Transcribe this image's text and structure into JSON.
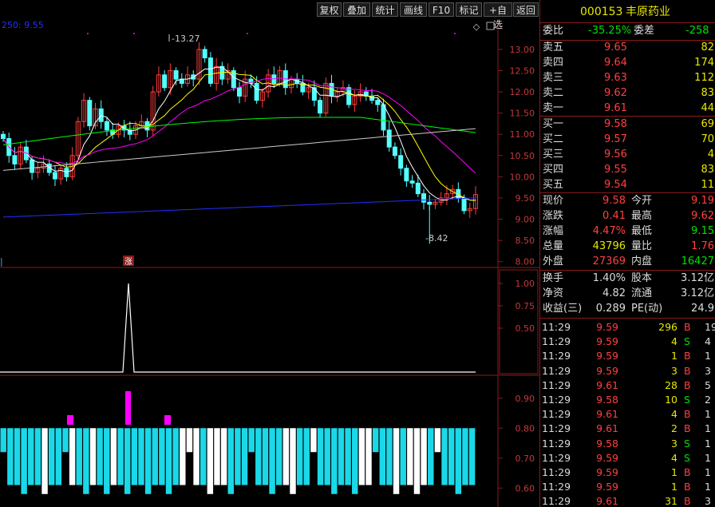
{
  "toolbar": {
    "buttons": [
      "复权",
      "叠加",
      "统计",
      "画线",
      "F10",
      "标记",
      "+自选",
      "返回"
    ]
  },
  "chart": {
    "ma_label": "250: 9.55",
    "high_label": "13.27",
    "low_label": "8.42",
    "zhang_label": "涨",
    "left_marker": "|",
    "price_ticks": [
      "13.00",
      "12.50",
      "12.00",
      "11.50",
      "11.00",
      "10.50",
      "10.00",
      "9.50",
      "9.00",
      "8.50",
      "8.00"
    ],
    "ind1_ticks": [
      "1.00",
      "0.75",
      "0.50"
    ],
    "ind2_ticks": [
      "0.90",
      "0.80",
      "0.70",
      "0.60"
    ],
    "colors": {
      "up": "#ff3c3c",
      "down": "#54ffff",
      "ma5": "#ffffff",
      "ma10": "#ffff00",
      "ma20": "#ff00ff",
      "ma60": "#00ff00",
      "ma120": "#cccccc",
      "ma250": "#2030ff",
      "grid": "#8b1a1a",
      "bar_cyan": "#1ad8e8",
      "bar_magenta": "#ff00ff"
    }
  },
  "chart_data": {
    "type": "candlestick",
    "price_range": [
      7.9,
      13.6
    ],
    "high": 13.27,
    "low": 8.42,
    "candles_close": [
      10.9,
      10.5,
      10.3,
      10.7,
      10.4,
      10.1,
      10.2,
      10.3,
      10.1,
      9.95,
      10.2,
      10.0,
      10.5,
      11.3,
      11.8,
      11.2,
      11.6,
      11.3,
      11.1,
      11.0,
      11.2,
      11.1,
      11.0,
      11.2,
      11.3,
      11.1,
      12.0,
      12.4,
      12.1,
      12.5,
      12.3,
      12.2,
      12.4,
      12.3,
      13.0,
      12.8,
      12.2,
      12.6,
      12.3,
      12.5,
      12.1,
      11.9,
      12.3,
      12.2,
      11.8,
      12.0,
      12.4,
      12.2,
      12.5,
      12.1,
      12.3,
      12.2,
      12.0,
      12.1,
      11.8,
      11.5,
      12.2,
      11.9,
      12.0,
      12.1,
      11.7,
      11.9,
      12.0,
      11.9,
      11.8,
      11.7,
      11.1,
      10.7,
      10.5,
      10.2,
      9.9,
      9.85,
      9.6,
      9.4,
      9.35,
      9.4,
      9.5,
      9.6,
      9.7,
      9.5,
      9.2,
      9.25,
      9.58
    ],
    "indicator1": {
      "spike_value": 1.0
    },
    "indicator2_range": [
      0.55,
      0.95
    ]
  },
  "quote": {
    "code": "000153",
    "name": "丰原药业",
    "weibi_label": "委比",
    "weibi_value": "-35.25%",
    "weicha_label": "委差",
    "weicha_value": "-258",
    "asks": [
      {
        "label": "卖五",
        "price": "9.65",
        "vol": "82"
      },
      {
        "label": "卖四",
        "price": "9.64",
        "vol": "174"
      },
      {
        "label": "卖三",
        "price": "9.63",
        "vol": "112"
      },
      {
        "label": "卖二",
        "price": "9.62",
        "vol": "83"
      },
      {
        "label": "卖一",
        "price": "9.61",
        "vol": "44"
      }
    ],
    "bids": [
      {
        "label": "买一",
        "price": "9.58",
        "vol": "69"
      },
      {
        "label": "买二",
        "price": "9.57",
        "vol": "70"
      },
      {
        "label": "买三",
        "price": "9.56",
        "vol": "4"
      },
      {
        "label": "买四",
        "price": "9.55",
        "vol": "83"
      },
      {
        "label": "买五",
        "price": "9.54",
        "vol": "11"
      }
    ],
    "stats": [
      {
        "l1": "现价",
        "v1": "9.58",
        "c1": "red",
        "l2": "今开",
        "v2": "9.19",
        "c2": "red"
      },
      {
        "l1": "涨跌",
        "v1": "0.41",
        "c1": "red",
        "l2": "最高",
        "v2": "9.62",
        "c2": "red"
      },
      {
        "l1": "涨幅",
        "v1": "4.47%",
        "c1": "red",
        "l2": "最低",
        "v2": "9.15",
        "c2": "green"
      },
      {
        "l1": "总量",
        "v1": "43796",
        "c1": "yellow",
        "l2": "量比",
        "v2": "1.76",
        "c2": "red"
      },
      {
        "l1": "外盘",
        "v1": "27369",
        "c1": "red",
        "l2": "内盘",
        "v2": "16427",
        "c2": "green"
      }
    ],
    "stats2": [
      {
        "l1": "换手",
        "v1": "1.40%",
        "l2": "股本",
        "v2": "3.12亿"
      },
      {
        "l1": "净资",
        "v1": "4.82",
        "l2": "流通",
        "v2": "3.12亿"
      },
      {
        "l1": "收益(三)",
        "v1": "0.289",
        "l2": "PE(动)",
        "v2": "24.9"
      }
    ],
    "ticks": [
      {
        "time": "11:29",
        "price": "9.59",
        "vol": "296",
        "side": "B",
        "n": "19"
      },
      {
        "time": "11:29",
        "price": "9.59",
        "vol": "4",
        "side": "S",
        "n": "4"
      },
      {
        "time": "11:29",
        "price": "9.59",
        "vol": "1",
        "side": "B",
        "n": "1"
      },
      {
        "time": "11:29",
        "price": "9.59",
        "vol": "3",
        "side": "B",
        "n": "3"
      },
      {
        "time": "11:29",
        "price": "9.61",
        "vol": "28",
        "side": "B",
        "n": "5"
      },
      {
        "time": "11:29",
        "price": "9.58",
        "vol": "10",
        "side": "S",
        "n": "2"
      },
      {
        "time": "11:29",
        "price": "9.61",
        "vol": "4",
        "side": "B",
        "n": "1"
      },
      {
        "time": "11:29",
        "price": "9.61",
        "vol": "2",
        "side": "B",
        "n": "1"
      },
      {
        "time": "11:29",
        "price": "9.58",
        "vol": "3",
        "side": "S",
        "n": "1"
      },
      {
        "time": "11:29",
        "price": "9.59",
        "vol": "4",
        "side": "S",
        "n": "1"
      },
      {
        "time": "11:29",
        "price": "9.59",
        "vol": "1",
        "side": "B",
        "n": "1"
      },
      {
        "time": "11:29",
        "price": "9.59",
        "vol": "1",
        "side": "B",
        "n": "1"
      },
      {
        "time": "11:29",
        "price": "9.61",
        "vol": "31",
        "side": "B",
        "n": "3"
      }
    ]
  }
}
